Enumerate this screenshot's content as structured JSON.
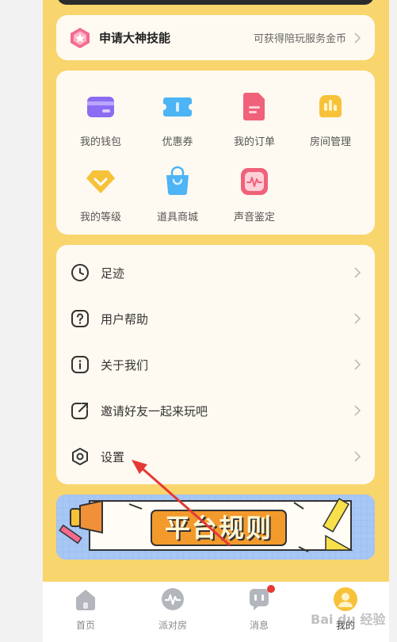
{
  "skill": {
    "title": "申请大神技能",
    "desc": "可获得陪玩服务金币"
  },
  "grid": [
    {
      "label": "我的钱包",
      "icon": "wallet-icon"
    },
    {
      "label": "优惠券",
      "icon": "coupon-icon"
    },
    {
      "label": "我的订单",
      "icon": "order-icon"
    },
    {
      "label": "房间管理",
      "icon": "room-manage-icon"
    },
    {
      "label": "我的等级",
      "icon": "level-icon"
    },
    {
      "label": "道具商城",
      "icon": "shop-bag-icon"
    },
    {
      "label": "声音鉴定",
      "icon": "voice-wave-icon"
    }
  ],
  "menu": [
    {
      "label": "足迹",
      "icon": "clock-icon"
    },
    {
      "label": "用户帮助",
      "icon": "help-icon"
    },
    {
      "label": "关于我们",
      "icon": "info-icon"
    },
    {
      "label": "邀请好友一起来玩吧",
      "icon": "share-icon"
    },
    {
      "label": "设置",
      "icon": "settings-icon"
    }
  ],
  "banner": {
    "text": "平台规则"
  },
  "tabs": [
    {
      "label": "首页",
      "icon": "home-icon"
    },
    {
      "label": "派对房",
      "icon": "party-icon"
    },
    {
      "label": "消息",
      "icon": "message-icon",
      "badge": true
    },
    {
      "label": "我的",
      "icon": "profile-icon",
      "active": true
    }
  ],
  "watermark": "Bai du 经验",
  "colors": {
    "background": "#f9d56e",
    "card": "#fffaf1",
    "accent_red": "#e53935"
  }
}
